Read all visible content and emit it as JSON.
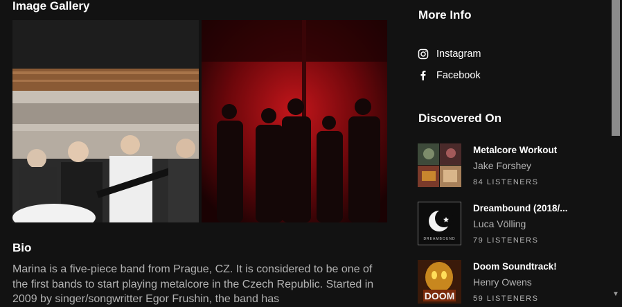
{
  "gallery": {
    "title": "Image Gallery"
  },
  "bio": {
    "title": "Bio",
    "text": "Marina is a five-piece band from Prague, CZ. It is considered to be one of the first bands to start playing metalcore in the Czech Republic. Started in 2009 by singer/songwritter Egor Frushin, the band has"
  },
  "more_info": {
    "title": "More Info",
    "links": [
      {
        "label": "Instagram",
        "icon": "instagram-icon"
      },
      {
        "label": "Facebook",
        "icon": "facebook-icon"
      }
    ]
  },
  "discovered_on": {
    "title": "Discovered On",
    "playlists": [
      {
        "title": "Metalcore Workout",
        "owner": "Jake Forshey",
        "listeners": "84 LISTENERS"
      },
      {
        "title": "Dreambound (2018/...",
        "owner": "Luca Völling",
        "listeners": "79 LISTENERS",
        "cover_text": "DREAMBOUND"
      },
      {
        "title": "Doom Soundtrack!",
        "owner": "Henry Owens",
        "listeners": "59 LISTENERS",
        "cover_text": "DOOM"
      }
    ]
  },
  "colors": {
    "background": "#121212",
    "text": "#ffffff",
    "subtext": "#b3b3b3"
  }
}
